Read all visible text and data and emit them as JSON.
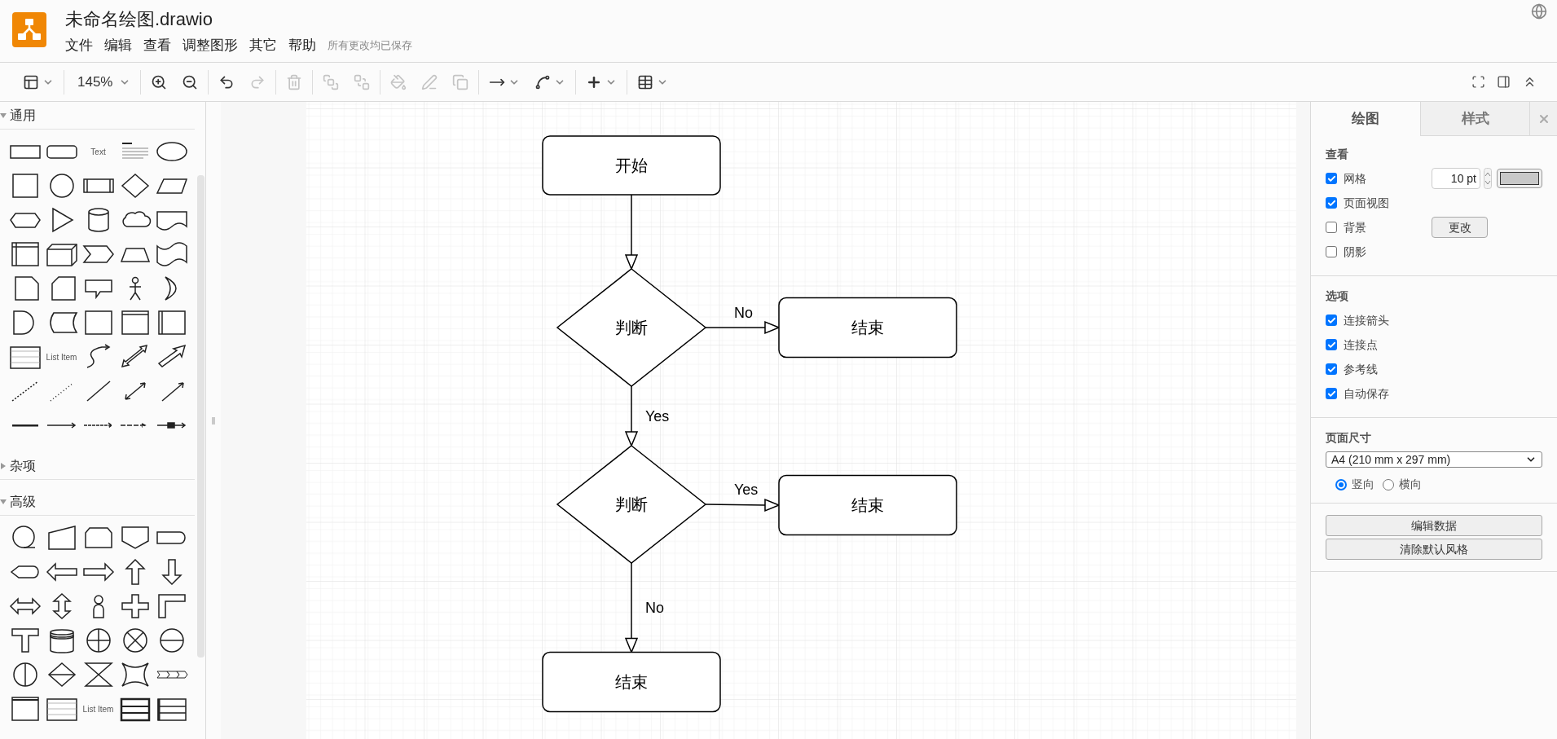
{
  "app": {
    "title": "未命名绘图.drawio",
    "save_status": "所有更改均已保存"
  },
  "menu": [
    "文件",
    "编辑",
    "查看",
    "调整图形",
    "其它",
    "帮助"
  ],
  "toolbar": {
    "groups": [
      [
        {
          "kind": "format",
          "disabled": false
        }
      ],
      [
        {
          "kind": "zoom",
          "label": "145%",
          "disabled": false
        }
      ],
      [
        {
          "kind": "zoom_in",
          "disabled": false
        },
        {
          "kind": "zoom_out",
          "disabled": false
        }
      ],
      [
        {
          "kind": "undo",
          "disabled": false
        },
        {
          "kind": "redo",
          "disabled": true
        }
      ],
      [
        {
          "kind": "delete",
          "disabled": true
        }
      ],
      [
        {
          "kind": "to_front",
          "disabled": true
        },
        {
          "kind": "to_back",
          "disabled": true
        }
      ],
      [
        {
          "kind": "fill",
          "disabled": true
        },
        {
          "kind": "line_color",
          "disabled": true
        },
        {
          "kind": "shadow",
          "disabled": true
        }
      ],
      [
        {
          "kind": "connection",
          "disabled": false
        },
        {
          "kind": "waypoints",
          "disabled": false
        }
      ],
      [
        {
          "kind": "insert",
          "disabled": false
        }
      ],
      [
        {
          "kind": "table",
          "disabled": false
        }
      ]
    ]
  },
  "sidebar": {
    "sections": [
      {
        "title": "通用",
        "expanded": true,
        "items": [
          {
            "kind": "rect"
          },
          {
            "kind": "rounded"
          },
          {
            "kind": "text",
            "label": "Text"
          },
          {
            "kind": "heading"
          },
          {
            "kind": "ellipse"
          },
          {
            "kind": "square"
          },
          {
            "kind": "circle"
          },
          {
            "kind": "process"
          },
          {
            "kind": "diamond"
          },
          {
            "kind": "parallelogram"
          },
          {
            "kind": "hexagon"
          },
          {
            "kind": "triangle"
          },
          {
            "kind": "cylinder"
          },
          {
            "kind": "cloud"
          },
          {
            "kind": "document"
          },
          {
            "kind": "internal"
          },
          {
            "kind": "cube"
          },
          {
            "kind": "step"
          },
          {
            "kind": "trapezoid"
          },
          {
            "kind": "tape"
          },
          {
            "kind": "note"
          },
          {
            "kind": "card"
          },
          {
            "kind": "callout"
          },
          {
            "kind": "actor"
          },
          {
            "kind": "crescent"
          },
          {
            "kind": "delay"
          },
          {
            "kind": "datastore"
          },
          {
            "kind": "container"
          },
          {
            "kind": "window"
          },
          {
            "kind": "swimlane"
          },
          {
            "kind": "list"
          },
          {
            "kind": "text",
            "label": "List Item"
          },
          {
            "kind": "curved"
          },
          {
            "kind": "double_block"
          },
          {
            "kind": "block_arrow"
          },
          {
            "kind": "dashed"
          },
          {
            "kind": "dotted"
          },
          {
            "kind": "line"
          },
          {
            "kind": "bidir"
          },
          {
            "kind": "arrow"
          },
          {
            "kind": "thick"
          },
          {
            "kind": "link1"
          },
          {
            "kind": "link2"
          },
          {
            "kind": "link3"
          },
          {
            "kind": "link4"
          }
        ]
      },
      {
        "title": "杂项",
        "expanded": false
      },
      {
        "title": "高级",
        "expanded": true,
        "items": [
          {
            "kind": "tape_circle"
          },
          {
            "kind": "manual_input"
          },
          {
            "kind": "loop_limit"
          },
          {
            "kind": "offpage"
          },
          {
            "kind": "half_term"
          },
          {
            "kind": "display"
          },
          {
            "kind": "left_arrow"
          },
          {
            "kind": "right_arrow"
          },
          {
            "kind": "up_arrow"
          },
          {
            "kind": "down_arrow"
          },
          {
            "kind": "lr_arrow"
          },
          {
            "kind": "ud_arrow"
          },
          {
            "kind": "user"
          },
          {
            "kind": "cross"
          },
          {
            "kind": "corner"
          },
          {
            "kind": "tee"
          },
          {
            "kind": "storage"
          },
          {
            "kind": "or_circle"
          },
          {
            "kind": "sum"
          },
          {
            "kind": "circle_h"
          },
          {
            "kind": "circle_v"
          },
          {
            "kind": "sort"
          },
          {
            "kind": "collate"
          },
          {
            "kind": "star4"
          },
          {
            "kind": "chevrons"
          },
          {
            "kind": "container_header"
          },
          {
            "kind": "list"
          },
          {
            "kind": "text",
            "label": "List Item"
          },
          {
            "kind": "table_thick"
          },
          {
            "kind": "table_side"
          }
        ]
      }
    ]
  },
  "diagram": {
    "nodes": [
      {
        "kind": "terminal",
        "label": "开始"
      },
      {
        "kind": "decision",
        "label": "判断"
      },
      {
        "kind": "terminal",
        "label": "结束"
      },
      {
        "kind": "decision",
        "label": "判断"
      },
      {
        "kind": "terminal",
        "label": "结束"
      },
      {
        "kind": "terminal",
        "label": "结束"
      }
    ],
    "edge_labels": [
      {
        "label": "No"
      },
      {
        "label": "Yes"
      },
      {
        "label": "Yes"
      },
      {
        "label": "No"
      }
    ]
  },
  "format_panel": {
    "tabs": [
      {
        "label": "绘图",
        "selected": true
      },
      {
        "label": "样式",
        "selected": false
      }
    ],
    "view": {
      "title": "查看",
      "options": [
        {
          "label": "网格",
          "checked": true
        },
        {
          "label": "页面视图",
          "checked": true
        },
        {
          "label": "背景",
          "checked": false
        },
        {
          "label": "阴影",
          "checked": false
        }
      ],
      "grid_size": "10 pt",
      "change_button": "更改"
    },
    "options": {
      "title": "选项",
      "options": [
        {
          "label": "连接箭头",
          "checked": true
        },
        {
          "label": "连接点",
          "checked": true
        },
        {
          "label": "参考线",
          "checked": true
        },
        {
          "label": "自动保存",
          "checked": true
        }
      ]
    },
    "page_size": {
      "title": "页面尺寸",
      "value": "A4 (210 mm x 297 mm)",
      "orientation": [
        {
          "label": "竖向",
          "selected": true
        },
        {
          "label": "横向",
          "selected": false
        }
      ]
    },
    "buttons": [
      "编辑数据",
      "清除默认风格"
    ]
  }
}
